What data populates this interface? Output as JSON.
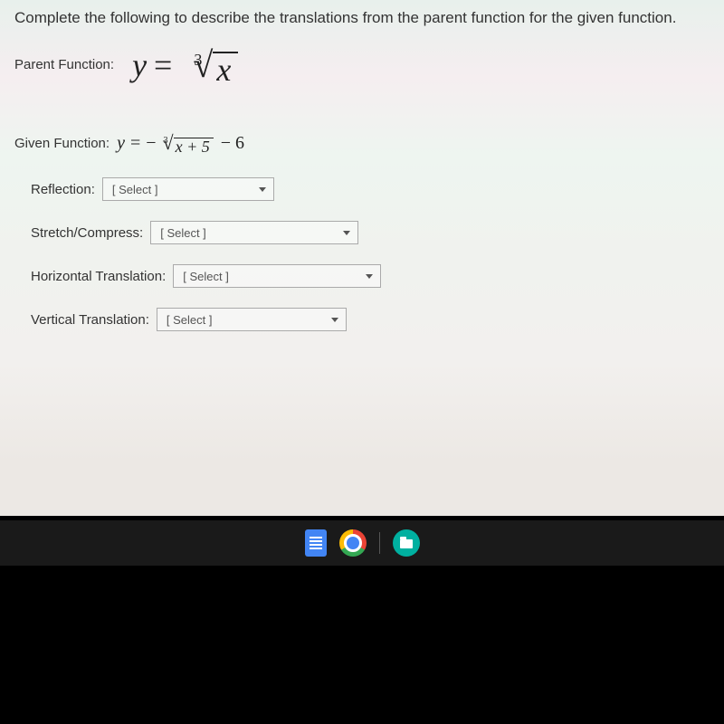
{
  "prompt": "Complete the following to describe the translations from the parent function for the given function.",
  "parent": {
    "label": "Parent Function:",
    "lhs": "y",
    "eq": "=",
    "root_index": "3",
    "radicand": "x"
  },
  "given": {
    "label": "Given Function:",
    "lhs": "y",
    "eq": "=",
    "neg": "−",
    "root_index": "3",
    "radicand": "x + 5",
    "tail": "− 6"
  },
  "selects": {
    "reflection": {
      "label": "Reflection:",
      "placeholder": "[ Select ]"
    },
    "stretch": {
      "label": "Stretch/Compress:",
      "placeholder": "[ Select ]"
    },
    "horizontal": {
      "label": "Horizontal Translation:",
      "placeholder": "[ Select ]"
    },
    "vertical": {
      "label": "Vertical Translation:",
      "placeholder": "[ Select ]"
    }
  },
  "taskbar": {
    "docs": "docs-icon",
    "chrome": "chrome-icon",
    "files": "files-icon"
  }
}
